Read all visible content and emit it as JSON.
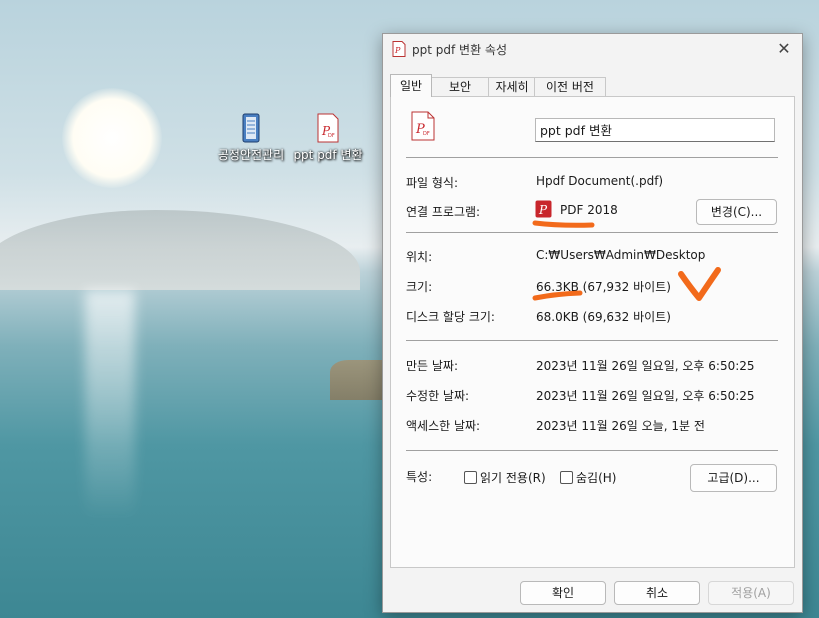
{
  "desktop": {
    "icons": [
      {
        "label": "공정안전관리",
        "icon": "document-binder-icon"
      },
      {
        "label": "ppt pdf 변환",
        "icon": "pdf-file-icon"
      }
    ]
  },
  "dialog": {
    "title": "ppt pdf 변환 속성",
    "close_glyph": "✕",
    "tabs": [
      {
        "label": "일반",
        "active": true
      },
      {
        "label": "보안",
        "active": false
      },
      {
        "label": "자세히",
        "active": false
      },
      {
        "label": "이전 버전",
        "active": false
      }
    ],
    "file_name": "ppt pdf 변환",
    "file_type_label": "파일 형식:",
    "file_type_value": "Hpdf Document(.pdf)",
    "opens_with_label": "연결 프로그램:",
    "opens_with_value": "PDF 2018",
    "change_button": "변경(C)...",
    "location_label": "위치:",
    "location_value": "C:₩Users₩Admin₩Desktop",
    "size_label": "크기:",
    "size_value": "66.3KB (67,932 바이트)",
    "disk_size_label": "디스크 할당 크기:",
    "disk_size_value": "68.0KB (69,632 바이트)",
    "created_label": "만든 날짜:",
    "created_value": "2023년 11월 26일 일요일, 오후 6:50:25",
    "modified_label": "수정한 날짜:",
    "modified_value": "2023년 11월 26일 일요일, 오후 6:50:25",
    "accessed_label": "액세스한 날짜:",
    "accessed_value": "2023년 11월 26일 오늘, 1분 전",
    "attributes_label": "특성:",
    "readonly_label": "읽기 전용(R)",
    "readonly_checked": false,
    "hidden_label": "숨김(H)",
    "hidden_checked": false,
    "advanced_button": "고급(D)...",
    "ok_button": "확인",
    "cancel_button": "취소",
    "apply_button": "적용(A)",
    "apply_enabled": false
  },
  "colors": {
    "annotation_orange": "#f26a1b",
    "pdf_red": "#c8262c"
  }
}
